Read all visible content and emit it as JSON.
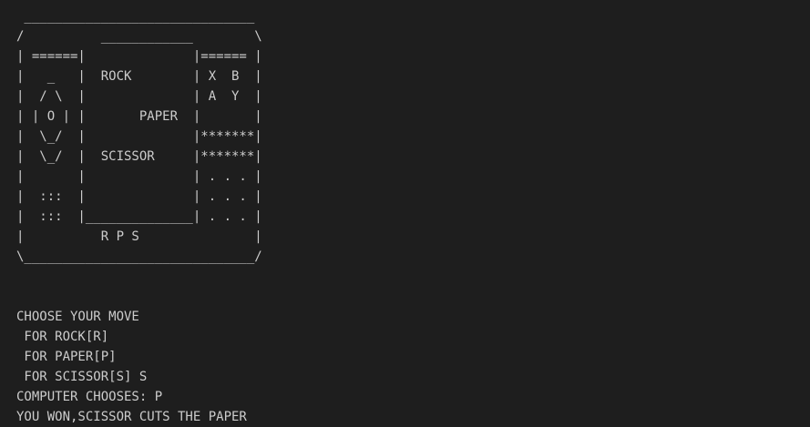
{
  "ascii_art": [
    " ______________________________",
    "/          ____________        \\",
    "| ======|              |====== |",
    "|   _   |  ROCK        | X  B  |",
    "|  / \\  |              | A  Y  |",
    "| | O | |       PAPER  |       |",
    "|  \\_/  |              |*******|",
    "|  \\_/  |  SCISSOR     |*******|",
    "|       |              | . . . |",
    "|  :::  |              | . . . |",
    "|  :::  |______________| . . . |",
    "|          R P S               |",
    "\\______________________________/"
  ],
  "output_lines": [
    "CHOOSE YOUR MOVE",
    " FOR ROCK[R]",
    " FOR PAPER[P]",
    " FOR SCISSOR[S] S",
    "COMPUTER CHOOSES: P",
    "YOU WON,SCISSOR CUTS THE PAPER"
  ]
}
